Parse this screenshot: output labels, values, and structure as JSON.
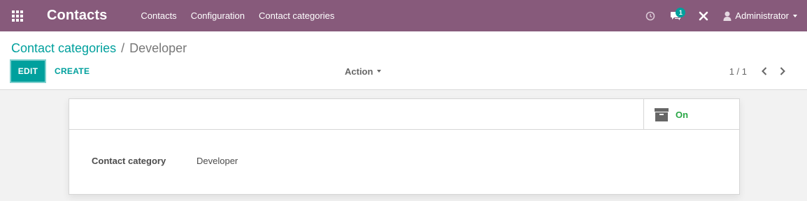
{
  "navbar": {
    "app_name": "Contacts",
    "menu": [
      "Contacts",
      "Configuration",
      "Contact categories"
    ],
    "messages_count": "1",
    "user_name": "Administrator",
    "bg_color": "#875a7b"
  },
  "breadcrumb": {
    "parent": "Contact categories",
    "separator": "/",
    "current": "Developer"
  },
  "toolbar": {
    "edit_label": "EDIT",
    "create_label": "CREATE",
    "action_label": "Action",
    "pager": "1 / 1",
    "accent_color": "#00a09d"
  },
  "form": {
    "active_toggle_label": "On",
    "field_label": "Contact category",
    "field_value": "Developer"
  },
  "icons": [
    "apps-grid-icon",
    "clock-icon",
    "chat-icon",
    "debug-tools-icon",
    "user-icon",
    "chevron-left-icon",
    "chevron-right-icon",
    "archive-icon"
  ]
}
